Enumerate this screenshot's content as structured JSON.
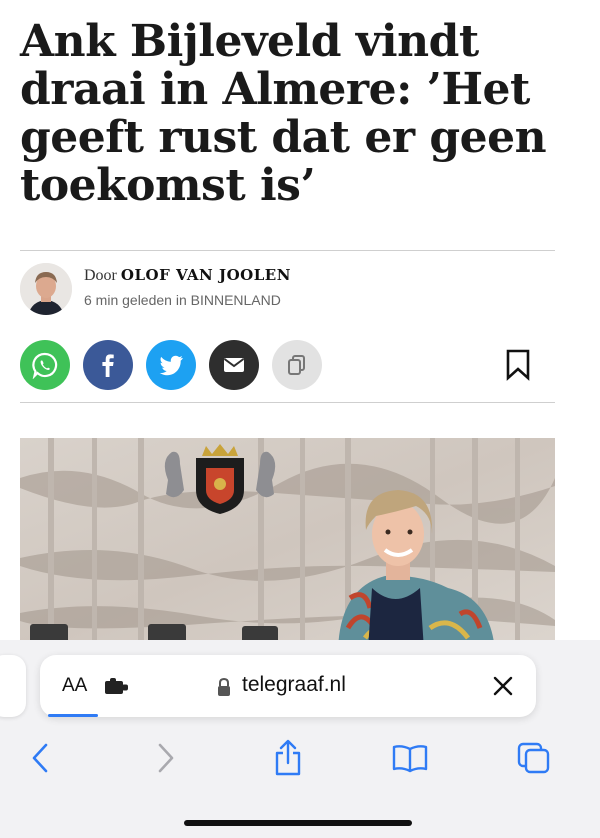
{
  "article": {
    "headline": "Ank Bijleveld vindt draai in Almere: ’Het geeft rust dat er geen toekomst is’",
    "byline_prefix": "Door ",
    "author": "OLOF VAN JOOLEN",
    "meta": "6 min geleden in BINNENLAND"
  },
  "share_buttons": [
    {
      "icon": "whatsapp-icon",
      "color": "#3fc258"
    },
    {
      "icon": "facebook-icon",
      "color": "#3b5998"
    },
    {
      "icon": "twitter-icon",
      "color": "#1da1f2"
    },
    {
      "icon": "email-icon",
      "color": "#333333"
    },
    {
      "icon": "copy-link-icon",
      "color": "#e2e2e2"
    }
  ],
  "bookmark_icon": "bookmark-icon",
  "browser": {
    "text_size_label": "AA",
    "url": "telegraaf.nl",
    "load_progress": 0.1
  },
  "toolbar_icons": [
    "back-icon",
    "forward-icon",
    "share-icon",
    "bookmarks-icon",
    "tabs-icon"
  ]
}
